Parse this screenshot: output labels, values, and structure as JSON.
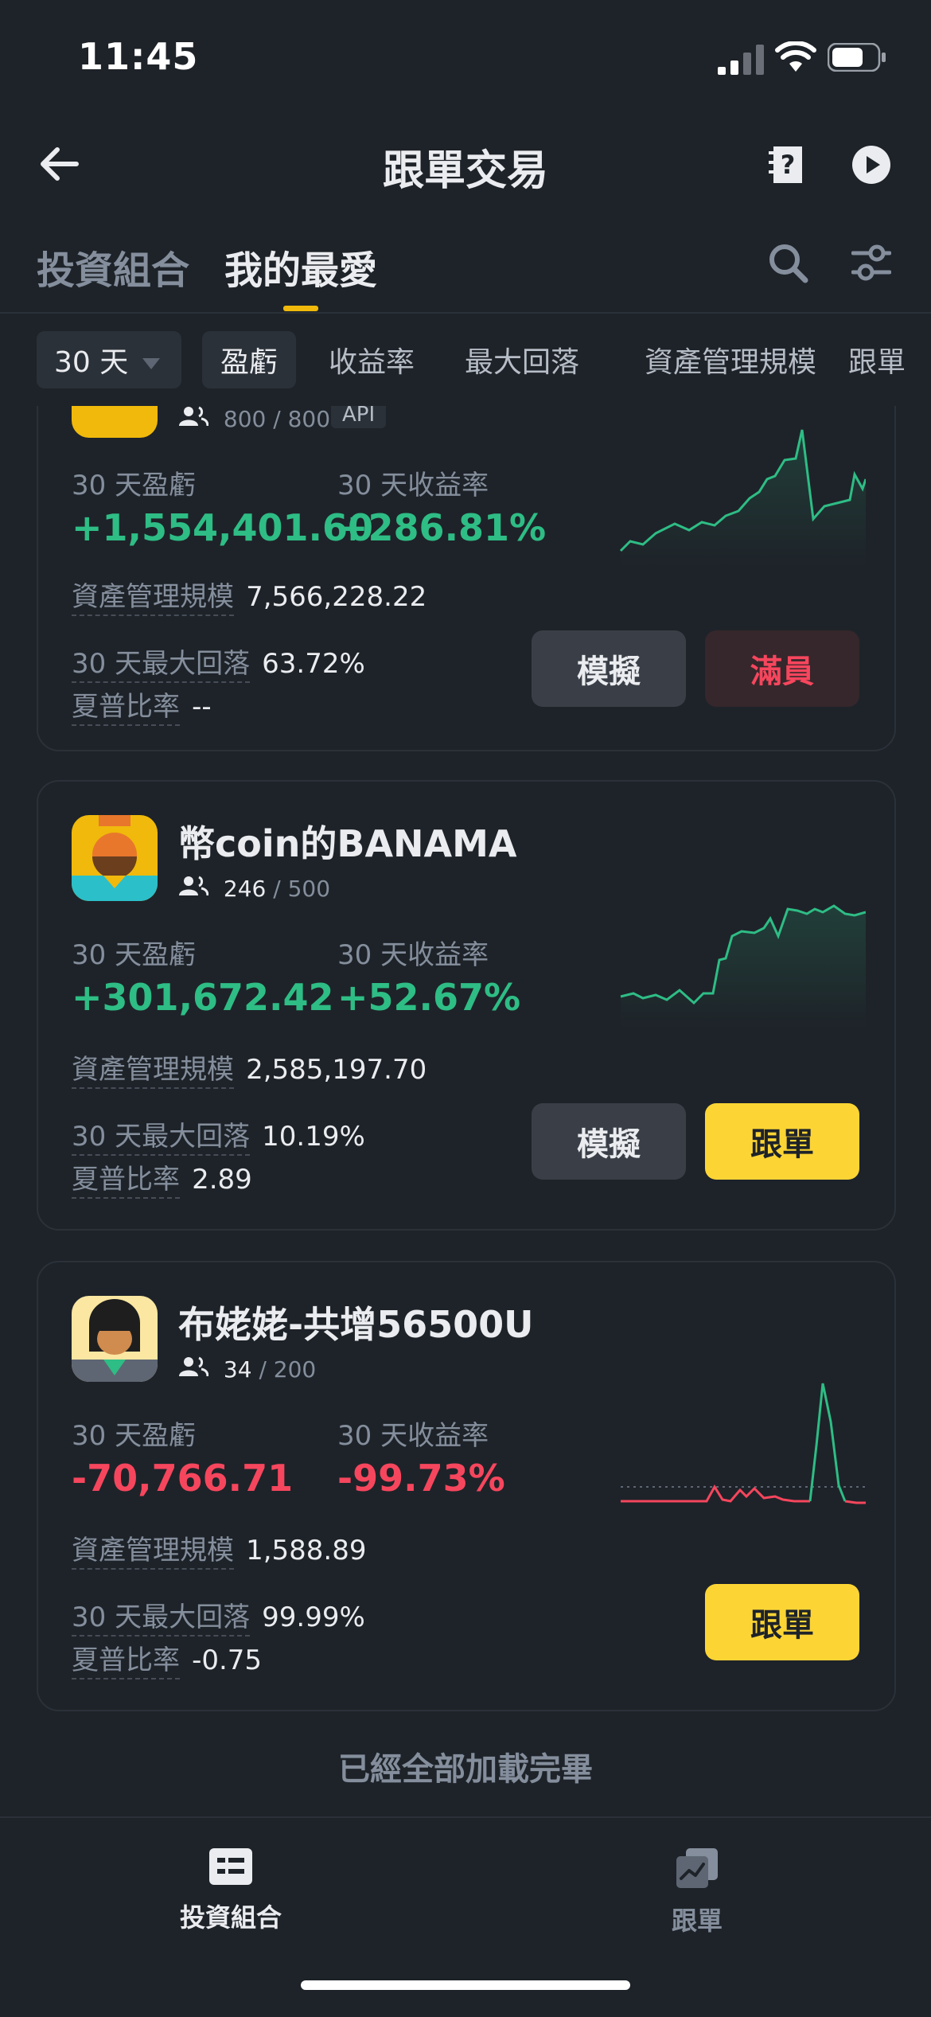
{
  "status_bar": {
    "time": "11:45"
  },
  "header": {
    "title": "跟單交易"
  },
  "tabs": [
    {
      "label": "投資組合",
      "active": false
    },
    {
      "label": "我的最愛",
      "active": true
    }
  ],
  "filters": {
    "period": "30 天",
    "chips": [
      "盈虧",
      "收益率",
      "最大回落",
      "資產管理規模",
      "跟單"
    ]
  },
  "cards": [
    {
      "followers_current": "800",
      "followers_max": "/ 800",
      "badge": "API",
      "pnl_label": "30 天盈虧",
      "pnl": "+1,554,401.60",
      "roi_label": "30 天收益率",
      "roi": "+286.81%",
      "aum_label": "資產管理規模",
      "aum": "7,566,228.22",
      "mdd_label": "30 天最大回落",
      "mdd": "63.72%",
      "sharpe_label": "夏普比率",
      "sharpe": "--",
      "btn_sim": "模擬",
      "btn_action": "滿員"
    },
    {
      "name": "幣coin的BANAMA",
      "followers_current": "246",
      "followers_max": "/ 500",
      "pnl_label": "30 天盈虧",
      "pnl": "+301,672.42",
      "roi_label": "30 天收益率",
      "roi": "+52.67%",
      "aum_label": "資產管理規模",
      "aum": "2,585,197.70",
      "mdd_label": "30 天最大回落",
      "mdd": "10.19%",
      "sharpe_label": "夏普比率",
      "sharpe": "2.89",
      "btn_sim": "模擬",
      "btn_action": "跟單"
    },
    {
      "name": "布姥姥-共增56500U",
      "followers_current": "34",
      "followers_max": "/ 200",
      "pnl_label": "30 天盈虧",
      "pnl": "-70,766.71",
      "roi_label": "30 天收益率",
      "roi": "-99.73%",
      "aum_label": "資產管理規模",
      "aum": "1,588.89",
      "mdd_label": "30 天最大回落",
      "mdd": "99.99%",
      "sharpe_label": "夏普比率",
      "sharpe": "-0.75",
      "btn_action": "跟單"
    }
  ],
  "footer_text": "已經全部加載完畢",
  "bottom_nav": [
    {
      "label": "投資組合",
      "active": true
    },
    {
      "label": "跟單",
      "active": false
    }
  ],
  "colors": {
    "accent": "#F0B90B",
    "positive": "#2EBD85",
    "negative": "#F6465D",
    "follow_button": "#FCD535"
  }
}
